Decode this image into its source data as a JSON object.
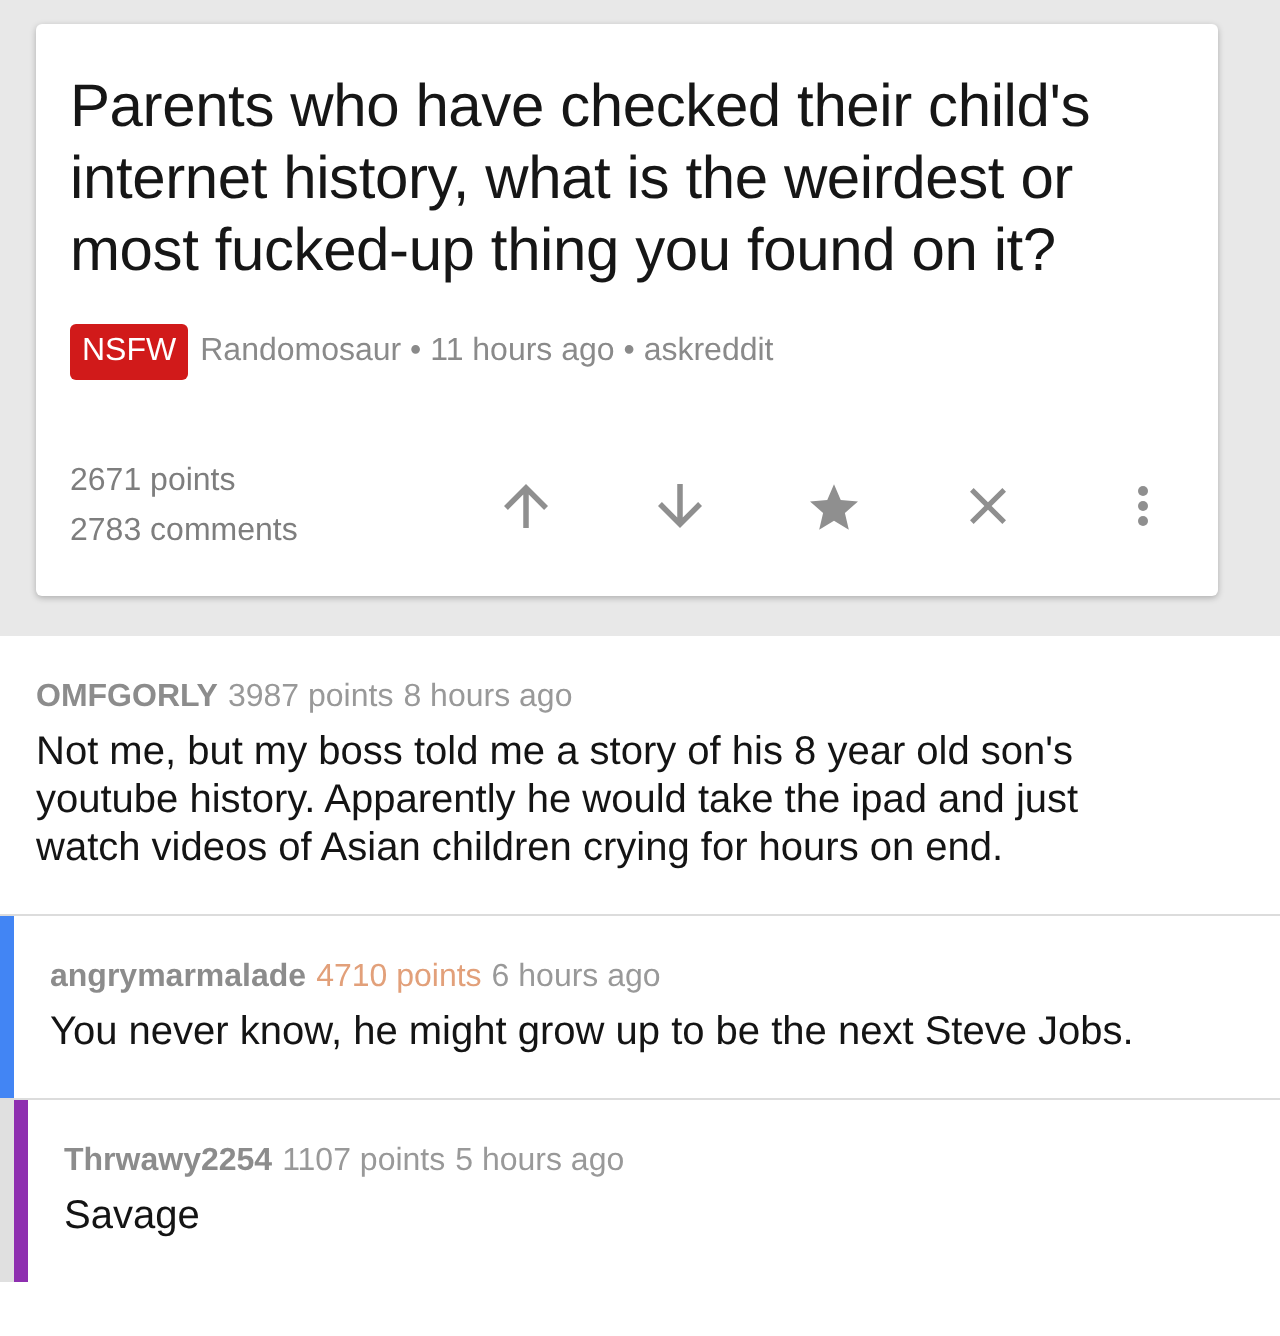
{
  "post": {
    "title": "Parents who have checked their child's internet history, what is the weirdest or most fucked-up thing you found on it?",
    "tag": "NSFW",
    "meta": "Randomosaur • 11 hours ago • askreddit",
    "score": "2671 points",
    "comment_count": "2783 comments"
  },
  "comments": [
    {
      "author": "OMFGORLY",
      "points": "3987 points",
      "time": "8 hours ago",
      "upvoted": false,
      "body": "Not me, but my boss told me a story of his 8 year old son's youtube history. Apparently he would take the ipad and just watch videos of Asian children crying for hours on end.",
      "children": [
        {
          "author": "angrymarmalade",
          "points": "4710 points",
          "time": "6 hours ago",
          "upvoted": true,
          "body": "You never know, he might grow up to be the next Steve Jobs.",
          "children": [
            {
              "author": "Thrwawy2254",
              "points": "1107 points",
              "time": "5 hours ago",
              "upvoted": false,
              "body": "Savage"
            }
          ]
        }
      ]
    }
  ]
}
